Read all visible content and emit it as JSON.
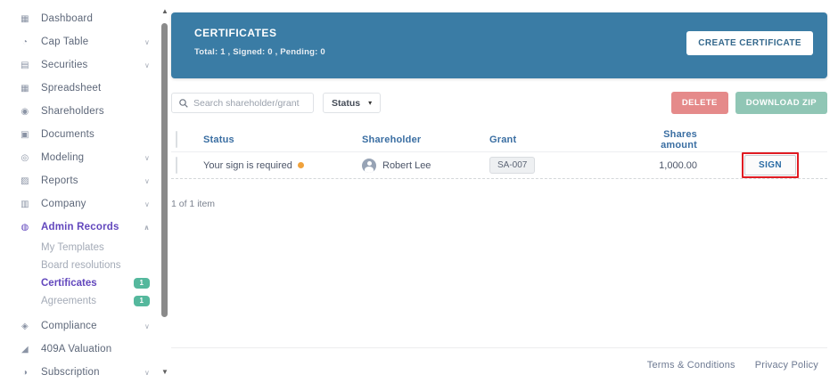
{
  "sidebar": {
    "items": [
      {
        "label": "Dashboard",
        "icon": "dashboard-icon"
      },
      {
        "label": "Cap Table",
        "icon": "pie-chart-icon",
        "chevron": "down"
      },
      {
        "label": "Securities",
        "icon": "clipboard-icon",
        "chevron": "down"
      },
      {
        "label": "Spreadsheet",
        "icon": "spreadsheet-icon"
      },
      {
        "label": "Shareholders",
        "icon": "person-icon"
      },
      {
        "label": "Documents",
        "icon": "folder-icon"
      },
      {
        "label": "Modeling",
        "icon": "lightbulb-icon",
        "chevron": "down"
      },
      {
        "label": "Reports",
        "icon": "report-icon",
        "chevron": "down"
      },
      {
        "label": "Company",
        "icon": "building-icon",
        "chevron": "down"
      },
      {
        "label": "Admin Records",
        "icon": "records-icon",
        "chevron": "up",
        "active": true
      },
      {
        "label": "My Templates"
      },
      {
        "label": "Board resolutions"
      },
      {
        "label": "Certificates",
        "badge": "1",
        "active": true
      },
      {
        "label": "Agreements",
        "badge": "1"
      },
      {
        "label": "Compliance",
        "icon": "shield-icon",
        "chevron": "down"
      },
      {
        "label": "409A Valuation",
        "icon": "chart-icon"
      },
      {
        "label": "Subscription",
        "icon": "dollar-icon",
        "chevron": "down"
      }
    ]
  },
  "header": {
    "title": "CERTIFICATES",
    "summary": "Total: 1 , Signed: 0 , Pending: 0",
    "create_button": "CREATE CERTIFICATE"
  },
  "toolbar": {
    "search_placeholder": "Search shareholder/grant",
    "status_label": "Status",
    "delete_button": "DELETE",
    "download_zip_button": "DOWNLOAD ZIP"
  },
  "table": {
    "columns": {
      "status": "Status",
      "shareholder": "Shareholder",
      "grant": "Grant",
      "shares": "Shares amount"
    },
    "rows": [
      {
        "status": "Your sign is required",
        "shareholder": "Robert Lee",
        "grant": "SA-007",
        "shares": "1,000.00",
        "action": "SIGN"
      }
    ]
  },
  "pagination": {
    "summary": "1 of 1 item"
  },
  "footer": {
    "terms": "Terms & Conditions",
    "privacy": "Privacy Policy"
  },
  "colors": {
    "hero_blue": "#3a7ca5",
    "accent_purple": "#6247bd",
    "badge_teal": "#55b89d",
    "delete_red": "#e58a8a",
    "zip_green": "#90c6b5",
    "highlight_red": "#e01b22",
    "pending_orange": "#f0a23c",
    "table_header_blue": "#3a6ea2"
  }
}
